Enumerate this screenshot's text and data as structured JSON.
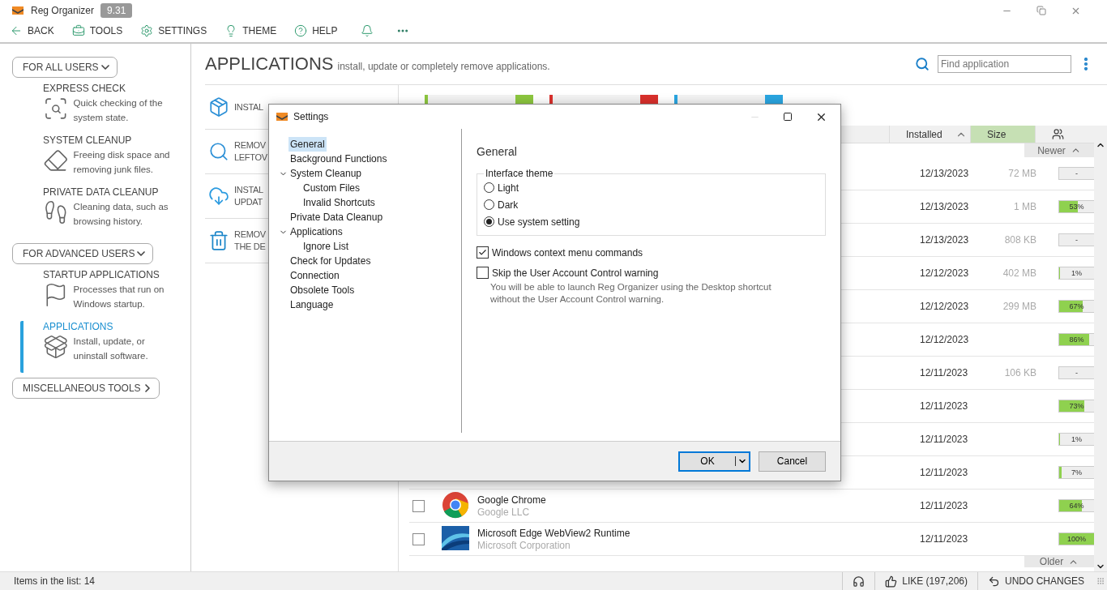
{
  "app": {
    "title": "Reg Organizer",
    "version": "9.31"
  },
  "toolbar": [
    {
      "kind": "back",
      "label": "BACK"
    },
    {
      "kind": "tools",
      "label": "TOOLS"
    },
    {
      "kind": "settings",
      "label": "SETTINGS"
    },
    {
      "kind": "theme",
      "label": "THEME"
    },
    {
      "kind": "help",
      "label": "HELP"
    },
    {
      "kind": "bell"
    },
    {
      "kind": "more"
    }
  ],
  "sidebar": [
    {
      "title": "FOR ALL USERS",
      "expanded": true,
      "items": [
        {
          "kind": "check",
          "title": "EXPRESS CHECK",
          "description": "Quick checking of the system state.",
          "selected": false
        },
        {
          "kind": "cleanup",
          "title": "SYSTEM CLEANUP",
          "description": "Freeing disk space and removing junk files.",
          "selected": false
        },
        {
          "kind": "private",
          "title": "PRIVATE DATA CLEANUP",
          "description": "Cleaning data, such as browsing history.",
          "selected": false
        }
      ]
    },
    {
      "title": "FOR ADVANCED USERS",
      "expanded": true,
      "items": [
        {
          "kind": "startup",
          "title": "STARTUP APPLICATIONS",
          "description": "Processes that run on Windows startup.",
          "selected": false
        },
        {
          "kind": "apps",
          "title": "APPLICATIONS",
          "description": "Install, update, or uninstall software.",
          "selected": true
        }
      ]
    },
    {
      "title": "MISCELLANEOUS TOOLS",
      "expanded": false
    }
  ],
  "page": {
    "title": "APPLICATIONS",
    "subtitle": "install, update or completely remove applications.",
    "search": {
      "placeholder": "Find application"
    }
  },
  "actions": [
    {
      "kind": "install",
      "lines": [
        "INSTAL"
      ]
    },
    {
      "kind": "leftovers",
      "lines": [
        "REMOV",
        "LEFTOV"
      ]
    },
    {
      "kind": "updates",
      "lines": [
        "INSTAL",
        "UPDAT"
      ]
    },
    {
      "kind": "remove",
      "lines": [
        "REMOV",
        "THE DE"
      ]
    }
  ],
  "filter_tabs": [
    {
      "color": "#8cc63f"
    },
    {
      "color": "#d9302c"
    },
    {
      "color": "#2aa5e0"
    }
  ],
  "table": {
    "columns": {
      "installed": "Installed",
      "size": "Size"
    },
    "newer": "Newer",
    "older": "Older",
    "rows": [
      {
        "installed": "12/13/2023",
        "size": "72 MB",
        "newer": "-",
        "level": 0
      },
      {
        "installed": "12/13/2023",
        "size": "1 MB",
        "newer": "53%",
        "level": 0.53
      },
      {
        "installed": "12/13/2023",
        "size": "808 KB",
        "newer": "-",
        "level": 0
      },
      {
        "installed": "12/12/2023",
        "size": "402 MB",
        "newer": "1%",
        "level": 0.01
      },
      {
        "installed": "12/12/2023",
        "size": "299 MB",
        "newer": "67%",
        "level": 0.67
      },
      {
        "installed": "12/12/2023",
        "newer": "86%",
        "level": 0.86
      },
      {
        "installed": "12/11/2023",
        "size": "106 KB",
        "newer": "-",
        "level": 0
      },
      {
        "installed": "12/11/2023",
        "newer": "73%",
        "level": 0.73
      },
      {
        "installed": "12/11/2023",
        "newer": "1%",
        "level": 0.01
      },
      {
        "installed": "12/11/2023",
        "newer": "7%",
        "level": 0.07
      },
      {
        "kind": "chrome",
        "name": "Google Chrome",
        "publisher": "Google LLC",
        "checked": false,
        "installed": "12/11/2023",
        "newer": "64%",
        "level": 0.64
      },
      {
        "kind": "edge",
        "name": "Microsoft Edge WebView2 Runtime",
        "publisher": "Microsoft Corporation",
        "checked": false,
        "installed": "12/11/2023",
        "newer": "100%",
        "level": 1
      }
    ]
  },
  "status_bar": {
    "items_count": "Items in the list: 14",
    "like": "LIKE (197,206)",
    "undo": "UNDO CHANGES"
  },
  "dialog": {
    "title": "Settings",
    "tree": [
      {
        "label": "General",
        "selected": true
      },
      {
        "label": "Background Functions",
        "selected": false
      },
      {
        "label": "System Cleanup",
        "selected": false,
        "expanded": true,
        "children": [
          {
            "label": "Custom Files",
            "selected": false
          },
          {
            "label": "Invalid Shortcuts",
            "selected": false
          }
        ]
      },
      {
        "label": "Private Data Cleanup",
        "selected": false
      },
      {
        "label": "Applications",
        "selected": false,
        "expanded": true,
        "children": [
          {
            "label": "Ignore List",
            "selected": false
          }
        ]
      },
      {
        "label": "Check for Updates",
        "selected": false
      },
      {
        "label": "Connection",
        "selected": false
      },
      {
        "label": "Obsolete Tools",
        "selected": false
      },
      {
        "label": "Language",
        "selected": false
      }
    ],
    "heading": "General",
    "theme_group": {
      "label": "Interface theme",
      "options": [
        {
          "label": "Light",
          "selected": false
        },
        {
          "label": "Dark",
          "selected": false
        },
        {
          "label": "Use system setting",
          "selected": true
        }
      ]
    },
    "options": [
      {
        "label": "Windows context menu commands",
        "checked": true
      },
      {
        "label": "Skip the User Account Control warning",
        "checked": false,
        "note": "You will be able to launch Reg Organizer using the Desktop shortcut without the User Account Control warning."
      }
    ],
    "buttons": {
      "ok": "OK",
      "cancel": "Cancel"
    }
  }
}
